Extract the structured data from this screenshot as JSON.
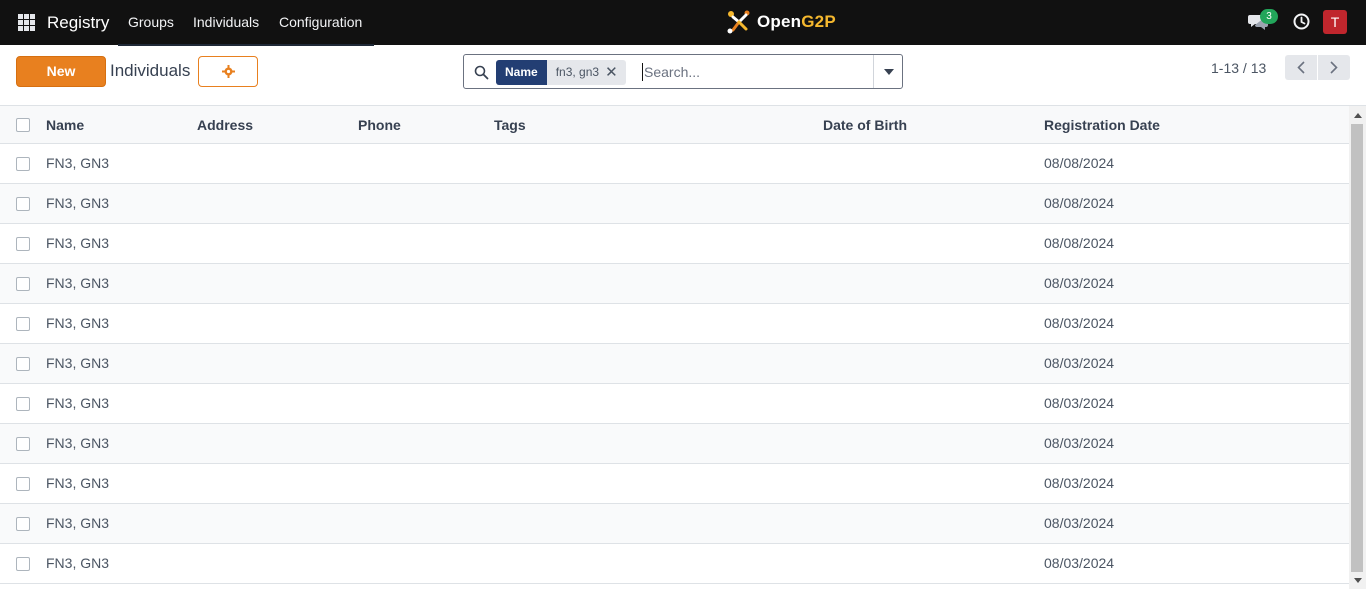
{
  "navbar": {
    "app_name": "Registry",
    "menu": [
      "Groups",
      "Individuals",
      "Configuration"
    ],
    "logo": {
      "prefix": "Open",
      "accent": "G2P"
    },
    "chat_count": "3",
    "avatar_initial": "T"
  },
  "control_panel": {
    "new_label": "New",
    "breadcrumb": "Individuals",
    "search": {
      "facet_label": "Name",
      "facet_value": "fn3, gn3",
      "placeholder": "Search..."
    },
    "pager": "1-13 / 13"
  },
  "table": {
    "columns": [
      "Name",
      "Address",
      "Phone",
      "Tags",
      "Date of Birth",
      "Registration Date"
    ],
    "rows": [
      {
        "name": "FN3, GN3",
        "address": "",
        "phone": "",
        "tags": "",
        "dob": "",
        "registration_date": "08/08/2024"
      },
      {
        "name": "FN3, GN3",
        "address": "",
        "phone": "",
        "tags": "",
        "dob": "",
        "registration_date": "08/08/2024"
      },
      {
        "name": "FN3, GN3",
        "address": "",
        "phone": "",
        "tags": "",
        "dob": "",
        "registration_date": "08/08/2024"
      },
      {
        "name": "FN3, GN3",
        "address": "",
        "phone": "",
        "tags": "",
        "dob": "",
        "registration_date": "08/03/2024"
      },
      {
        "name": "FN3, GN3",
        "address": "",
        "phone": "",
        "tags": "",
        "dob": "",
        "registration_date": "08/03/2024"
      },
      {
        "name": "FN3, GN3",
        "address": "",
        "phone": "",
        "tags": "",
        "dob": "",
        "registration_date": "08/03/2024"
      },
      {
        "name": "FN3, GN3",
        "address": "",
        "phone": "",
        "tags": "",
        "dob": "",
        "registration_date": "08/03/2024"
      },
      {
        "name": "FN3, GN3",
        "address": "",
        "phone": "",
        "tags": "",
        "dob": "",
        "registration_date": "08/03/2024"
      },
      {
        "name": "FN3, GN3",
        "address": "",
        "phone": "",
        "tags": "",
        "dob": "",
        "registration_date": "08/03/2024"
      },
      {
        "name": "FN3, GN3",
        "address": "",
        "phone": "",
        "tags": "",
        "dob": "",
        "registration_date": "08/03/2024"
      },
      {
        "name": "FN3, GN3",
        "address": "",
        "phone": "",
        "tags": "",
        "dob": "",
        "registration_date": "08/03/2024"
      }
    ]
  },
  "colors": {
    "navbar_bg": "#111111",
    "primary_orange": "#e8801f",
    "facet_blue": "#233e73",
    "badge_green": "#22a55a",
    "avatar_red": "#c0262d",
    "logo_accent": "#f5b82e"
  },
  "icons": {
    "apps": "apps-grid-icon",
    "gear": "gear-icon",
    "search": "search-icon",
    "chat": "chat-icon",
    "clock": "clock-icon",
    "caret": "caret-down-icon",
    "prev": "chevron-left-icon",
    "next": "chevron-right-icon"
  }
}
